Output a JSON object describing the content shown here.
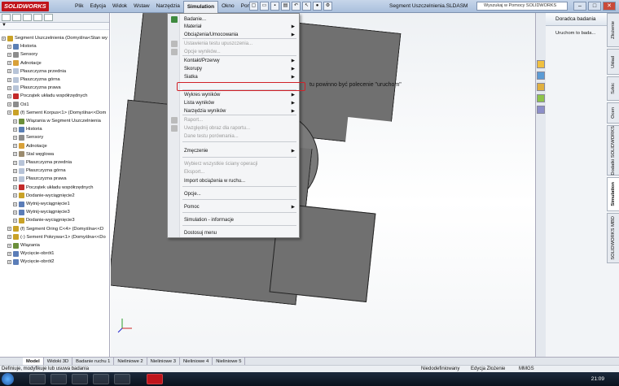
{
  "app": {
    "logo": "SOLIDWORKS",
    "doc_title": "Segment Uszczelnienia.SLDASM",
    "search_placeholder": "Wyszukaj w Pomocy SOLIDWORKS"
  },
  "menubar": {
    "items": [
      "Plik",
      "Edycja",
      "Widok",
      "Wstaw",
      "Narzędzia",
      "Simulation",
      "Okno",
      "Pomoc"
    ],
    "active": "Simulation"
  },
  "feature_tree": {
    "rows": [
      {
        "label": "Segment Uszczelnienia (Domyślna<Stan wy",
        "level": 0,
        "icon_color": "#c9a227"
      },
      {
        "label": "Historia",
        "level": 1,
        "icon_color": "#5a7fb5"
      },
      {
        "label": "Sensory",
        "level": 1,
        "icon_color": "#8c8c8c"
      },
      {
        "label": "Adnotacje",
        "level": 1,
        "icon_color": "#d8a13a"
      },
      {
        "label": "Płaszczyzna przednia",
        "level": 1,
        "icon_color": "#b7c4d8"
      },
      {
        "label": "Płaszczyzna górna",
        "level": 1,
        "icon_color": "#b7c4d8"
      },
      {
        "label": "Płaszczyzna prawa",
        "level": 1,
        "icon_color": "#b7c4d8"
      },
      {
        "label": "Początek układu współrzędnych",
        "level": 1,
        "icon_color": "#c42a2a"
      },
      {
        "label": "Oś1",
        "level": 1,
        "icon_color": "#8c8c8c"
      },
      {
        "label": "(f) Sement Korpus<1> (Domyślna<<Dom",
        "level": 1,
        "icon_color": "#c9a227"
      },
      {
        "label": "Wiązania w Segment Uszczelnienia",
        "level": 2,
        "icon_color": "#6b8f3a"
      },
      {
        "label": "Historia",
        "level": 2,
        "icon_color": "#5a7fb5"
      },
      {
        "label": "Sensory",
        "level": 2,
        "icon_color": "#8c8c8c"
      },
      {
        "label": "Adnotacje",
        "level": 2,
        "icon_color": "#d8a13a"
      },
      {
        "label": "Stal węglowa",
        "level": 2,
        "icon_color": "#9b8b6e"
      },
      {
        "label": "Płaszczyzna przednia",
        "level": 2,
        "icon_color": "#b7c4d8"
      },
      {
        "label": "Płaszczyzna górna",
        "level": 2,
        "icon_color": "#b7c4d8"
      },
      {
        "label": "Płaszczyzna prawa",
        "level": 2,
        "icon_color": "#b7c4d8"
      },
      {
        "label": "Początek układu współrzędnych",
        "level": 2,
        "icon_color": "#c42a2a"
      },
      {
        "label": "Dodanie-wyciągnięcie2",
        "level": 2,
        "icon_color": "#c9a227"
      },
      {
        "label": "Wytnij-wyciągnięcie1",
        "level": 2,
        "icon_color": "#5b7db8"
      },
      {
        "label": "Wytnij-wyciągnięcie3",
        "level": 2,
        "icon_color": "#5b7db8"
      },
      {
        "label": "Dodanie-wyciągnięcie3",
        "level": 2,
        "icon_color": "#c9a227"
      },
      {
        "label": "(f) Segment Oring C<4> (Domyślna<<D",
        "level": 1,
        "icon_color": "#c9a227"
      },
      {
        "label": "(-) Sement Pokrywa<1> (Domyślna<<Do",
        "level": 1,
        "icon_color": "#c9a227"
      },
      {
        "label": "Wiązania",
        "level": 1,
        "icon_color": "#6b8f3a"
      },
      {
        "label": "Wycięcie-obrót1",
        "level": 1,
        "icon_color": "#5b7db8"
      },
      {
        "label": "Wycięcie-obrót2",
        "level": 1,
        "icon_color": "#5b7db8"
      }
    ]
  },
  "sim_menu": {
    "items": [
      {
        "label": "Badanie...",
        "disabled": false,
        "submenu": false,
        "icon": "study-icon",
        "icon_color": "#3f8a3f"
      },
      {
        "label": "Materiał",
        "disabled": false,
        "submenu": true
      },
      {
        "label": "Obciążenia/Umocowania",
        "disabled": false,
        "submenu": true
      },
      {
        "label": "Ustawienia testu upuszczenia...",
        "disabled": true,
        "submenu": false,
        "icon": "drop-test-icon",
        "icon_color": "#bbbbbb"
      },
      {
        "label": "Opcje wyników...",
        "disabled": true,
        "submenu": false,
        "icon": "result-options-icon",
        "icon_color": "#bbbbbb"
      },
      {
        "label": "Kontakt/Przerwy",
        "disabled": false,
        "submenu": true
      },
      {
        "label": "Skorupy",
        "disabled": false,
        "submenu": true
      },
      {
        "label": "Siatka",
        "disabled": false,
        "submenu": true
      },
      {
        "label": "",
        "disabled": false,
        "submenu": false,
        "highlighted_empty": true
      },
      {
        "label": "Wykres wyników",
        "disabled": false,
        "submenu": true
      },
      {
        "label": "Lista wyników",
        "disabled": false,
        "submenu": true
      },
      {
        "label": "Narzędzia wyników",
        "disabled": false,
        "submenu": true
      },
      {
        "label": "Raport...",
        "disabled": true,
        "submenu": false,
        "icon": "report-icon",
        "icon_color": "#bbbbbb"
      },
      {
        "label": "Uwzględnij obraz dla raportu...",
        "disabled": true,
        "submenu": false,
        "icon": "image-icon",
        "icon_color": "#bbbbbb"
      },
      {
        "label": "Dane testu porównania...",
        "disabled": true,
        "submenu": false
      },
      {
        "label": "Zmęczenie",
        "disabled": false,
        "submenu": true
      },
      {
        "label": "Wybierz wszystkie ściany operacji",
        "disabled": true,
        "submenu": false
      },
      {
        "label": "Eksport...",
        "disabled": true,
        "submenu": false
      },
      {
        "label": "Import obciążenia w ruchu...",
        "disabled": false,
        "submenu": false
      },
      {
        "label": "Opcje...",
        "disabled": false,
        "submenu": false
      },
      {
        "label": "Pomoc",
        "disabled": false,
        "submenu": true
      },
      {
        "label": "Simulation - informacje",
        "disabled": false,
        "submenu": false
      },
      {
        "label": "Dostosuj menu",
        "disabled": false,
        "submenu": false
      }
    ]
  },
  "annotation_text": "tu powinno być polecenie \"uruchom\"",
  "task_pane": {
    "header": "Doradca badania",
    "link": "Uruchom to bada...",
    "vtabs": [
      "Złożenie",
      "Układ",
      "Szkic",
      "Ocen",
      "Dodatki SOLIDWORKS",
      "Simulation",
      "SOLIDWORKS MBD"
    ],
    "active_vtab": "Simulation"
  },
  "bottom_tabs": {
    "items": [
      "Model",
      "Widoki 3D",
      "Badanie ruchu 1",
      "Nieliniowe 2",
      "Nieliniowe 3",
      "Nieliniowe 4",
      "Nieliniowe 5"
    ],
    "active": "Model"
  },
  "status": {
    "left": "Definiuje, modyfikuje lub usuwa badania",
    "defined": "Niedodefiniowany",
    "mode": "Edycja Złożenie",
    "units": "MMGS"
  },
  "clock": "21:09"
}
